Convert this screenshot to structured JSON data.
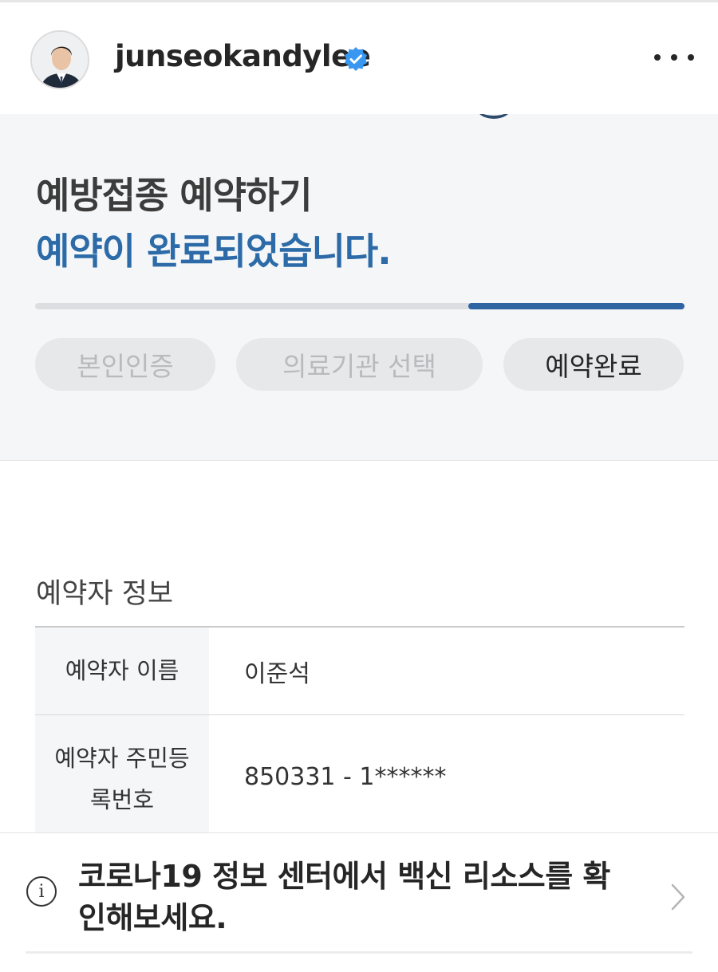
{
  "header": {
    "username": "junseokandylee",
    "verified_color": "#3897f0"
  },
  "booking": {
    "title": "예방접종 예약하기",
    "subtitle": "예약이 완료되었습니다.",
    "progress_fraction": 0.333,
    "steps": [
      {
        "label": "본인인증",
        "active": false
      },
      {
        "label": "의료기관 선택",
        "active": false
      },
      {
        "label": "예약완료",
        "active": true
      }
    ],
    "accent_color": "#2c6aa8"
  },
  "info": {
    "section_title": "예약자 정보",
    "rows": [
      {
        "label": "예약자 이름",
        "value": "이준석"
      },
      {
        "label": "예약자 주민등록번호",
        "value": "850331 - 1******"
      }
    ]
  },
  "banner": {
    "text": "코로나19 정보 센터에서 백신 리소스를 확인해보세요.",
    "icon": "info-icon"
  }
}
